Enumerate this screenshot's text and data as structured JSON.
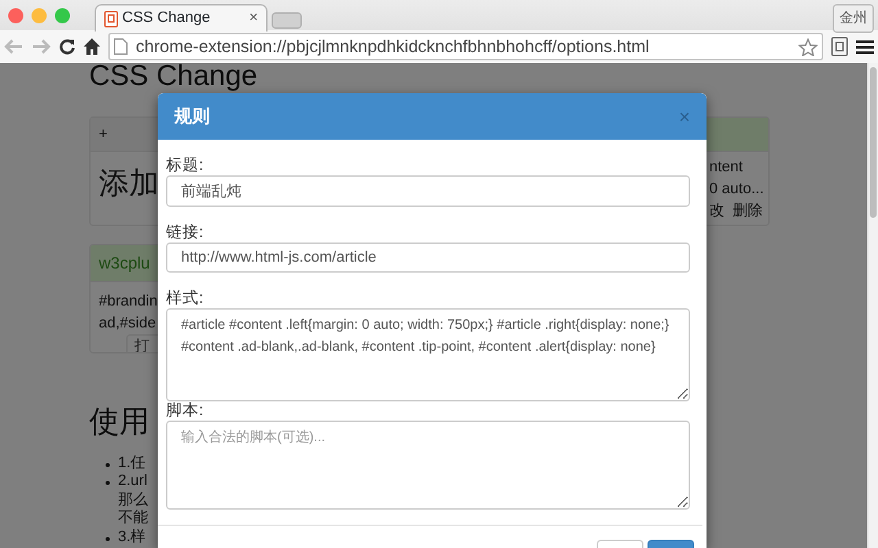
{
  "browser": {
    "tab": {
      "title": "CSS Change",
      "close": "×"
    },
    "profile_button": "金州",
    "address": "chrome-extension://pbjcjlmnknpdhkidcknchfbhnbhohcff/options.html"
  },
  "page": {
    "heading": "CSS Change",
    "add_card": {
      "header": "+",
      "body": "添加"
    },
    "right_card": {
      "lines": [
        "ntent",
        "0 auto..."
      ],
      "actions": [
        "改",
        "删除"
      ]
    },
    "rule_card": {
      "title": "w3cplu",
      "lines": [
        "#brandin",
        "ad,#side"
      ],
      "button": "打"
    },
    "usage": {
      "heading": "使用",
      "items": [
        {
          "lines": [
            "1.任"
          ]
        },
        {
          "lines": [
            "2.url",
            "那么",
            "不能"
          ]
        },
        {
          "lines": [
            "3.样"
          ]
        }
      ]
    }
  },
  "modal": {
    "title": "规则",
    "close": "×",
    "fields": [
      {
        "label": "标题:",
        "kind": "input",
        "value": "前端乱炖"
      },
      {
        "label": "链接:",
        "kind": "input",
        "value": "http://www.html-js.com/article"
      },
      {
        "label": "样式:",
        "kind": "textarea",
        "value": "#article #content .left{margin: 0 auto; width: 750px;} #article .right{display: none;} #content .ad-blank,.ad-blank, #content .tip-point, #content .alert{display: none}"
      },
      {
        "label": "脚本:",
        "kind": "textarea",
        "placeholder": "输入合法的脚本(可选)..."
      }
    ],
    "footer_buttons": [
      {
        "kind": "default"
      },
      {
        "kind": "primary"
      }
    ]
  }
}
